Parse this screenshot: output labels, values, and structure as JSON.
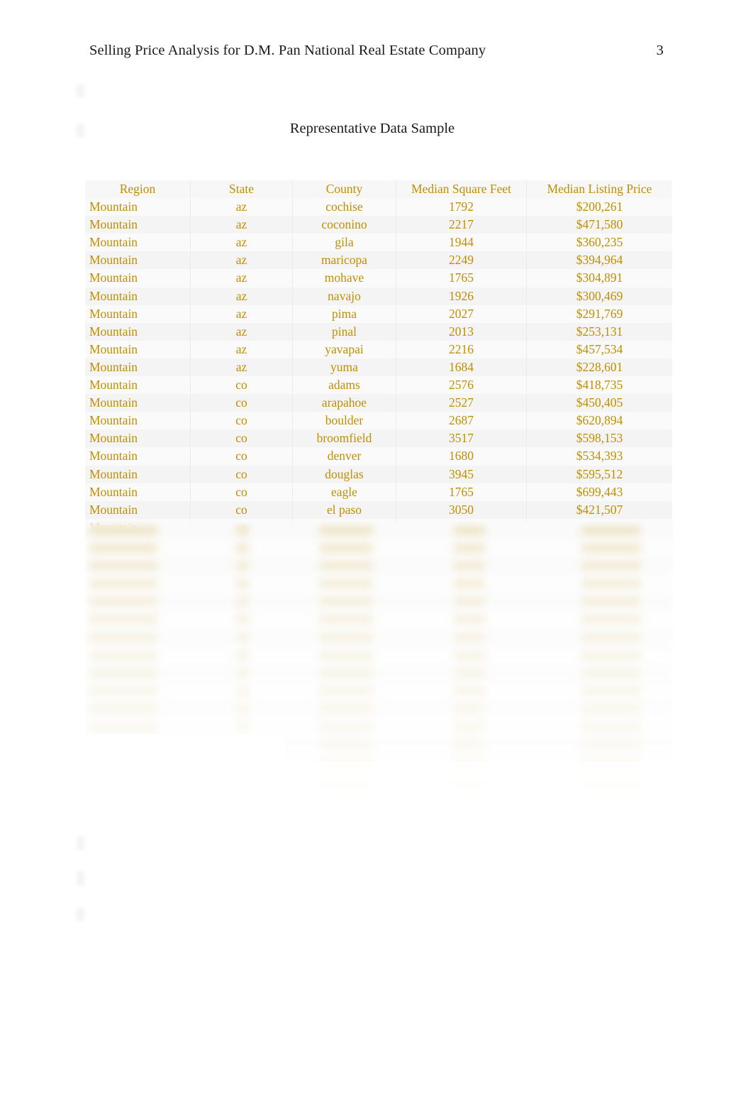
{
  "header": {
    "title": "Selling Price Analysis for D.M. Pan National Real Estate Company",
    "page_number": "3"
  },
  "section": {
    "title": "Representative Data Sample"
  },
  "table": {
    "columns": [
      "Region",
      "State",
      "County",
      "Median Square Feet",
      "Median Listing Price"
    ],
    "rows": [
      {
        "region": "Mountain",
        "state": "az",
        "county": "cochise",
        "sqft": "1792",
        "price": "$200,261"
      },
      {
        "region": "Mountain",
        "state": "az",
        "county": "coconino",
        "sqft": "2217",
        "price": "$471,580"
      },
      {
        "region": "Mountain",
        "state": "az",
        "county": "gila",
        "sqft": "1944",
        "price": "$360,235"
      },
      {
        "region": "Mountain",
        "state": "az",
        "county": "maricopa",
        "sqft": "2249",
        "price": "$394,964"
      },
      {
        "region": "Mountain",
        "state": "az",
        "county": "mohave",
        "sqft": "1765",
        "price": "$304,891"
      },
      {
        "region": "Mountain",
        "state": "az",
        "county": "navajo",
        "sqft": "1926",
        "price": "$300,469"
      },
      {
        "region": "Mountain",
        "state": "az",
        "county": "pima",
        "sqft": "2027",
        "price": "$291,769"
      },
      {
        "region": "Mountain",
        "state": "az",
        "county": "pinal",
        "sqft": "2013",
        "price": "$253,131"
      },
      {
        "region": "Mountain",
        "state": "az",
        "county": "yavapai",
        "sqft": "2216",
        "price": "$457,534"
      },
      {
        "region": "Mountain",
        "state": "az",
        "county": "yuma",
        "sqft": "1684",
        "price": "$228,601"
      },
      {
        "region": "Mountain",
        "state": "co",
        "county": "adams",
        "sqft": "2576",
        "price": "$418,735"
      },
      {
        "region": "Mountain",
        "state": "co",
        "county": "arapahoe",
        "sqft": "2527",
        "price": "$450,405"
      },
      {
        "region": "Mountain",
        "state": "co",
        "county": "boulder",
        "sqft": "2687",
        "price": "$620,894"
      },
      {
        "region": "Mountain",
        "state": "co",
        "county": "broomfield",
        "sqft": "3517",
        "price": "$598,153"
      },
      {
        "region": "Mountain",
        "state": "co",
        "county": "denver",
        "sqft": "1680",
        "price": "$534,393"
      },
      {
        "region": "Mountain",
        "state": "co",
        "county": "douglas",
        "sqft": "3945",
        "price": "$595,512"
      },
      {
        "region": "Mountain",
        "state": "co",
        "county": "eagle",
        "sqft": "1765",
        "price": "$699,443"
      },
      {
        "region": "Mountain",
        "state": "co",
        "county": "el paso",
        "sqft": "3050",
        "price": "$421,507"
      },
      {
        "region": "Mountain",
        "state": "co",
        "county": "",
        "sqft": "",
        "price": ""
      }
    ]
  },
  "colors": {
    "table_text": "#bf8f00",
    "body_text": "#1a1a1a",
    "page_background": "#ffffff"
  }
}
